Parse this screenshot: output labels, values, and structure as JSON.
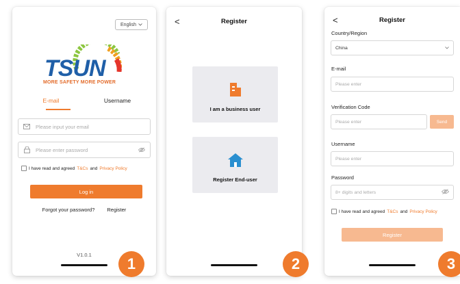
{
  "screen1": {
    "language": "English",
    "brand": {
      "wordmark": "TSUN",
      "tagline": "MORE SAFETY MORE POWER"
    },
    "tabs": [
      "E-mail",
      "Username"
    ],
    "email_placeholder": "Please input your email",
    "password_placeholder": "Please enter password",
    "agree_prefix": "I have read and agreed",
    "terms_label": "T&Cs",
    "and_label": "and",
    "privacy_label": "Privacy Policy",
    "login_label": "Log in",
    "forgot_label": "Forgot your password?",
    "register_label": "Register",
    "version": "V1.0.1",
    "step": "1"
  },
  "screen2": {
    "back": "<",
    "title": "Register",
    "business_label": "I am a business user",
    "enduser_label": "Register End-user",
    "step": "2"
  },
  "screen3": {
    "back": "<",
    "title": "Register",
    "country_label": "Country/Region",
    "country_value": "China",
    "email_label": "E-mail",
    "email_placeholder": "Please enter",
    "code_label": "Verification Code",
    "code_placeholder": "Please enter",
    "send_label": "Send",
    "username_label": "Username",
    "username_placeholder": "Please enter",
    "password_label": "Password",
    "password_placeholder": "8+ digits and letters",
    "agree_prefix": "I have read and agreed",
    "terms_label": "T&Cs",
    "and_label": "and",
    "privacy_label": "Privacy Policy",
    "register_label": "Register",
    "step": "3"
  },
  "colors": {
    "accent": "#ef7b2d",
    "accent_disabled": "#f7b990",
    "brand_blue": "#1f5fa8",
    "card": "#ebebef"
  }
}
